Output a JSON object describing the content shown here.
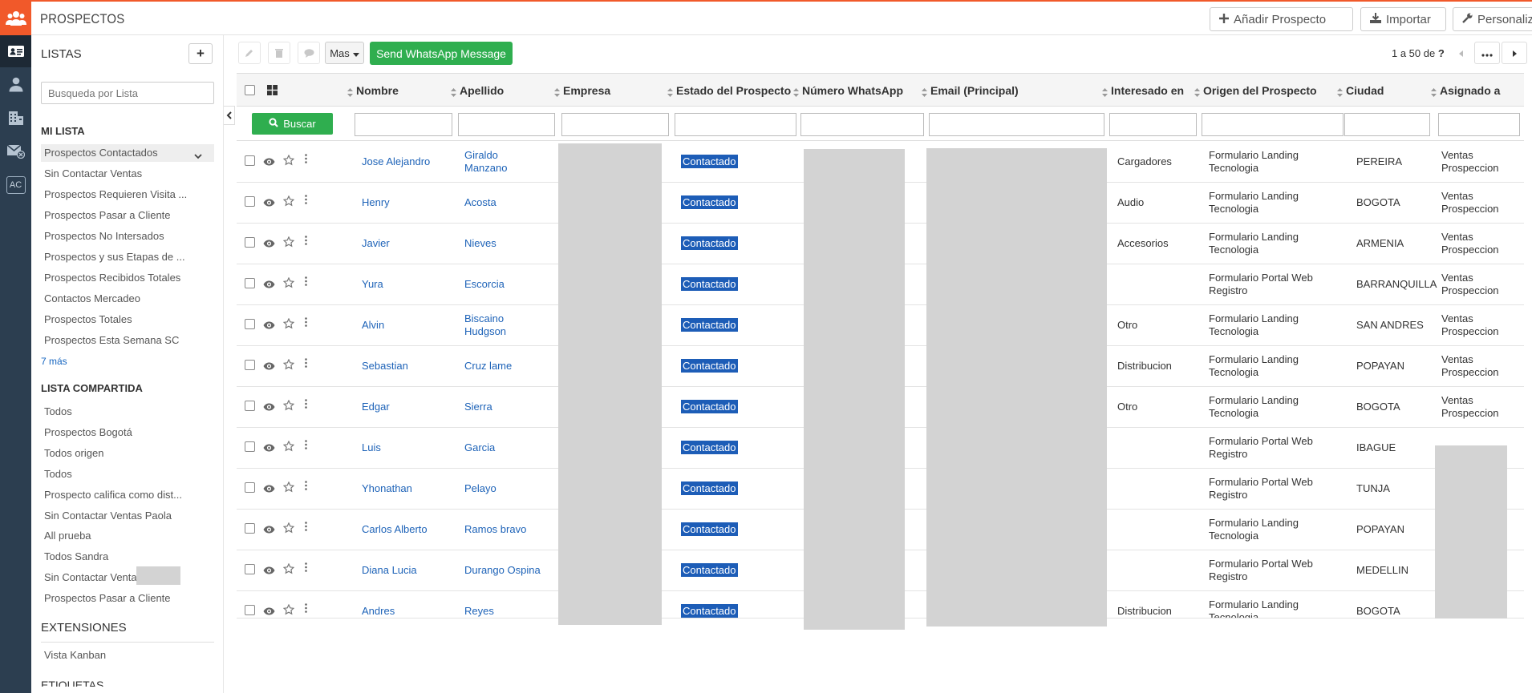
{
  "app": {
    "module_title": "PROSPECTOS",
    "rail": [
      {
        "icon": "users-logo-icon"
      },
      {
        "icon": "contact-card-icon"
      },
      {
        "icon": "user-icon"
      },
      {
        "icon": "building-icon"
      },
      {
        "icon": "email-icon"
      },
      {
        "icon": "ac-badge-icon",
        "label": "AC"
      }
    ]
  },
  "header": {
    "add_label": "Añadir Prospecto",
    "import_label": "Importar",
    "customize_label": "Personalizar"
  },
  "sidebar": {
    "lists_title": "LISTAS",
    "add_symbol": "+",
    "search_placeholder": "Busqueda por Lista",
    "my_list_title": "MI LISTA",
    "my_list": [
      "Prospectos Contactados",
      "Sin Contactar Ventas",
      "Prospectos Requieren Visita ...",
      "Prospectos Pasar a Cliente",
      "Prospectos No Intersados",
      "Prospectos y sus Etapas de ...",
      "Prospectos Recibidos Totales",
      "Contactos Mercadeo",
      "Prospectos Totales",
      "Prospectos Esta Semana SC"
    ],
    "more_label": "7 más",
    "shared_title": "LISTA COMPARTIDA",
    "shared_list": [
      "Todos",
      "Prospectos Bogotá",
      "Todos origen",
      "Todos",
      "Prospecto califica como dist...",
      "Sin Contactar Ventas Paola",
      "All prueba",
      "Todos Sandra",
      "Sin Contactar Ventas",
      "Prospectos Pasar a Cliente"
    ],
    "extensions_title": "EXTENSIONES",
    "extensions": [
      "Vista Kanban"
    ],
    "tags_title": "ETIQUETAS"
  },
  "toolbar": {
    "more_label": "Mas",
    "whatsapp_label": "Send WhatsApp Message",
    "pager_text": "1 a 50  de",
    "pager_total": "?"
  },
  "table": {
    "columns": [
      "Nombre",
      "Apellido",
      "Empresa",
      "Estado del Prospecto",
      "Número WhatsApp",
      "Email (Principal)",
      "Interesado en",
      "Origen del Prospecto",
      "Ciudad",
      "Asignado a"
    ],
    "search_label": "Buscar",
    "rows": [
      {
        "nombre": "Jose Alejandro",
        "apellido": [
          "Giraldo",
          "Manzano"
        ],
        "estado": "Contactado",
        "interes": "Cargadores",
        "origen": [
          "Formulario Landing",
          "Tecnologia"
        ],
        "ciudad": "PEREIRA",
        "asignado": [
          "Ventas",
          "Prospeccion"
        ]
      },
      {
        "nombre": "Henry",
        "apellido": [
          "Acosta"
        ],
        "estado": "Contactado",
        "interes": "Audio",
        "origen": [
          "Formulario Landing",
          "Tecnologia"
        ],
        "ciudad": "BOGOTA",
        "asignado": [
          "Ventas",
          "Prospeccion"
        ]
      },
      {
        "nombre": "Javier",
        "apellido": [
          "Nieves"
        ],
        "estado": "Contactado",
        "interes": "Accesorios",
        "origen": [
          "Formulario Landing",
          "Tecnologia"
        ],
        "ciudad": "ARMENIA",
        "asignado": [
          "Ventas",
          "Prospeccion"
        ]
      },
      {
        "nombre": "Yura",
        "apellido": [
          "Escorcia"
        ],
        "estado": "Contactado",
        "interes": "",
        "origen": [
          "Formulario Portal Web",
          "Registro"
        ],
        "ciudad": "BARRANQUILLA",
        "asignado": [
          "Ventas",
          "Prospeccion"
        ]
      },
      {
        "nombre": "Alvin",
        "apellido": [
          "Biscaino",
          "Hudgson"
        ],
        "estado": "Contactado",
        "interes": "Otro",
        "origen": [
          "Formulario Landing",
          "Tecnologia"
        ],
        "ciudad": "SAN ANDRES",
        "asignado": [
          "Ventas",
          "Prospeccion"
        ]
      },
      {
        "nombre": "Sebastian",
        "apellido": [
          "Cruz lame"
        ],
        "estado": "Contactado",
        "interes": "Distribucion",
        "origen": [
          "Formulario Landing",
          "Tecnologia"
        ],
        "ciudad": "POPAYAN",
        "asignado": [
          "Ventas",
          "Prospeccion"
        ]
      },
      {
        "nombre": "Edgar",
        "apellido": [
          "Sierra"
        ],
        "estado": "Contactado",
        "interes": "Otro",
        "origen": [
          "Formulario Landing",
          "Tecnologia"
        ],
        "ciudad": "BOGOTA",
        "asignado": [
          "Ventas",
          "Prospeccion"
        ]
      },
      {
        "nombre": "Luis",
        "apellido": [
          "Garcia"
        ],
        "estado": "Contactado",
        "interes": "",
        "origen": [
          "Formulario Portal Web",
          "Registro"
        ],
        "ciudad": "IBAGUE",
        "asignado": []
      },
      {
        "nombre": "Yhonathan",
        "apellido": [
          "Pelayo"
        ],
        "estado": "Contactado",
        "interes": "",
        "origen": [
          "Formulario Portal Web",
          "Registro"
        ],
        "ciudad": "TUNJA",
        "asignado": []
      },
      {
        "nombre": "Carlos Alberto",
        "apellido": [
          "Ramos bravo"
        ],
        "estado": "Contactado",
        "interes": "",
        "origen": [
          "Formulario Landing",
          "Tecnologia"
        ],
        "ciudad": "POPAYAN",
        "asignado": []
      },
      {
        "nombre": "Diana Lucia",
        "apellido": [
          "Durango Ospina"
        ],
        "estado": "Contactado",
        "interes": "",
        "origen": [
          "Formulario Portal Web",
          "Registro"
        ],
        "ciudad": "MEDELLIN",
        "asignado": []
      },
      {
        "nombre": "Andres",
        "apellido": [
          "Reyes"
        ],
        "estado": "Contactado",
        "interes": "Distribucion",
        "origen": [
          "Formulario Landing",
          "Tecnologia"
        ],
        "ciudad": "BOGOTA",
        "asignado": []
      }
    ]
  }
}
